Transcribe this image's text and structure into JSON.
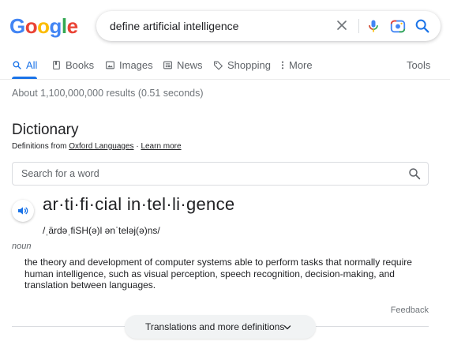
{
  "logo": {
    "letters": [
      "G",
      "o",
      "o",
      "g",
      "l",
      "e"
    ],
    "colors": [
      "#4285f4",
      "#ea4335",
      "#fbbc05",
      "#4285f4",
      "#34a853",
      "#ea4335"
    ]
  },
  "search": {
    "query": "define artificial intelligence"
  },
  "tabs": [
    {
      "label": "All",
      "icon": "search-icon",
      "active": true
    },
    {
      "label": "Books",
      "icon": "book-icon"
    },
    {
      "label": "Images",
      "icon": "image-icon"
    },
    {
      "label": "News",
      "icon": "news-icon"
    },
    {
      "label": "Shopping",
      "icon": "tag-icon"
    },
    {
      "label": "More",
      "icon": "more-vert-icon"
    }
  ],
  "tools_label": "Tools",
  "result_stats": "About 1,100,000,000 results (0.51 seconds)",
  "dictionary": {
    "title": "Dictionary",
    "source_prefix": "Definitions from",
    "source_link": "Oxford Languages",
    "separator": "·",
    "learn_more": "Learn more",
    "search_placeholder": "Search for a word",
    "word": "ar·ti·fi·cial in·tel·li·gence",
    "phonetic": "/ˌärdəˌfiSH(ə)l ənˈteləj(ə)ns/",
    "part_of_speech": "noun",
    "definition": "the theory and development of computer systems able to perform tasks that normally require human intelligence, such as visual perception, speech recognition, decision-making, and translation between languages.",
    "feedback": "Feedback",
    "more_button": "Translations and more definitions"
  },
  "colors": {
    "accent": "#1a73e8",
    "muted": "#5f6368"
  }
}
